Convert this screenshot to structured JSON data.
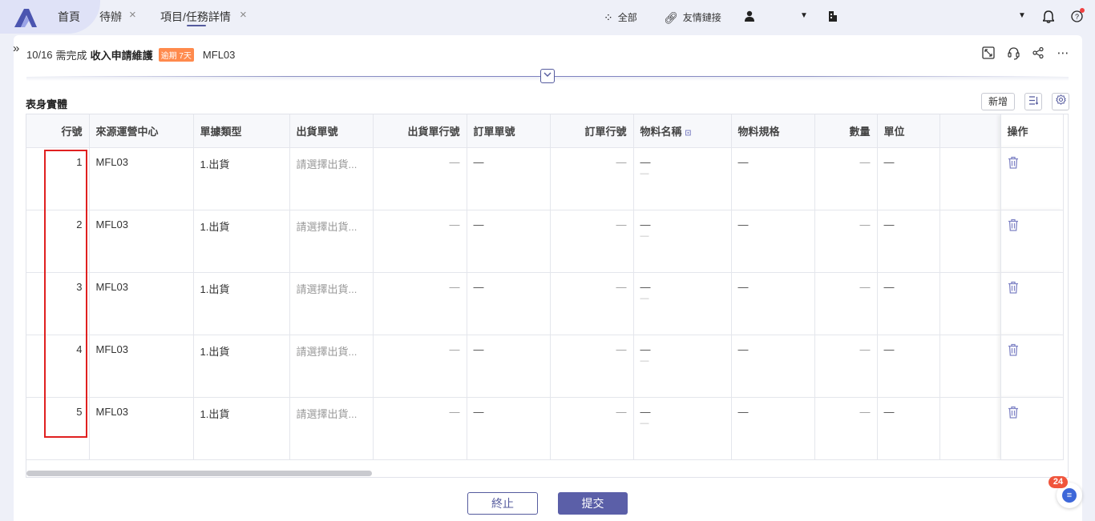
{
  "topbar": {
    "tabs": [
      {
        "label": "首頁"
      },
      {
        "label": "待辦"
      },
      {
        "label": "項目/任務詳情"
      }
    ],
    "all_label": "全部",
    "links_label": "友情鏈接"
  },
  "task": {
    "date": "10/16",
    "prefix": "需完成",
    "title": "收入申請維護",
    "overdue": "逾期 7天",
    "code": "MFL03"
  },
  "section": {
    "title": "表身實體",
    "add_label": "新增"
  },
  "table": {
    "columns": [
      "行號",
      "來源運營中心",
      "單據類型",
      "出貨單號",
      "出貨單行號",
      "訂單單號",
      "訂單行號",
      "物料名稱",
      "物料規格",
      "數量",
      "單位",
      "",
      "操作"
    ],
    "rows": [
      {
        "no": "1",
        "center": "MFL03",
        "type": "1.出貨",
        "ship_no": "請選擇出貨...",
        "ship_line": "—",
        "order_no": "—",
        "order_line": "—",
        "material": "—",
        "material_sub": "—",
        "spec": "—",
        "qty": "—",
        "unit": "—"
      },
      {
        "no": "2",
        "center": "MFL03",
        "type": "1.出貨",
        "ship_no": "請選擇出貨...",
        "ship_line": "—",
        "order_no": "—",
        "order_line": "—",
        "material": "—",
        "material_sub": "—",
        "spec": "—",
        "qty": "—",
        "unit": "—"
      },
      {
        "no": "3",
        "center": "MFL03",
        "type": "1.出貨",
        "ship_no": "請選擇出貨...",
        "ship_line": "—",
        "order_no": "—",
        "order_line": "—",
        "material": "—",
        "material_sub": "—",
        "spec": "—",
        "qty": "—",
        "unit": "—"
      },
      {
        "no": "4",
        "center": "MFL03",
        "type": "1.出貨",
        "ship_no": "請選擇出貨...",
        "ship_line": "—",
        "order_no": "—",
        "order_line": "—",
        "material": "—",
        "material_sub": "—",
        "spec": "—",
        "qty": "—",
        "unit": "—"
      },
      {
        "no": "5",
        "center": "MFL03",
        "type": "1.出貨",
        "ship_no": "請選擇出貨...",
        "ship_line": "—",
        "order_no": "—",
        "order_line": "—",
        "material": "—",
        "material_sub": "—",
        "spec": "—",
        "qty": "—",
        "unit": "—"
      }
    ]
  },
  "footer": {
    "stop_label": "終止",
    "submit_label": "提交"
  },
  "chat": {
    "badge": "24"
  },
  "colors": {
    "accent": "#5b5fa8",
    "overdue": "#ff8a4d",
    "highlight": "#e02020"
  }
}
